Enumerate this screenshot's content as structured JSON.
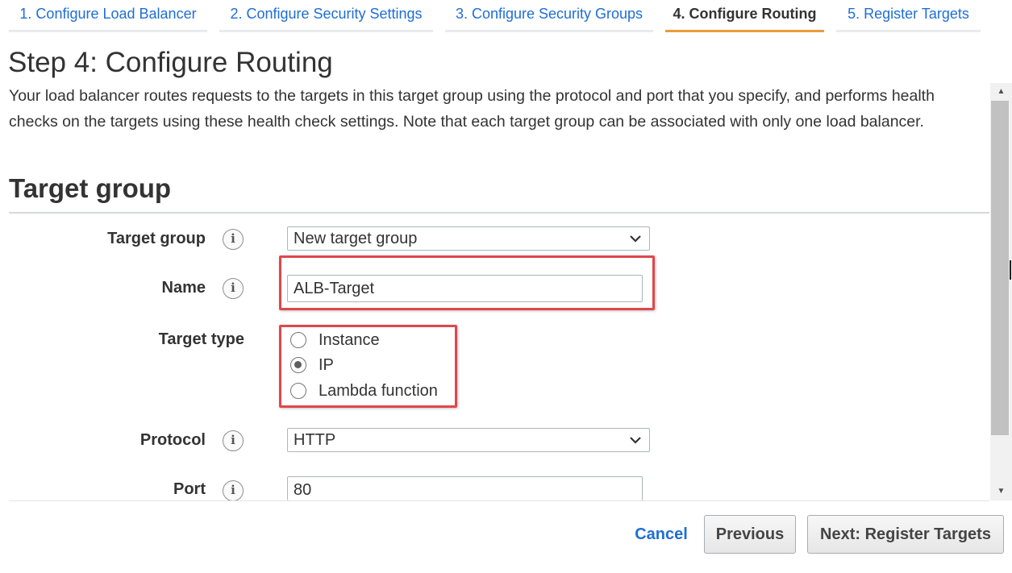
{
  "wizard": {
    "tabs": [
      {
        "label": "1. Configure Load Balancer",
        "active": false
      },
      {
        "label": "2. Configure Security Settings",
        "active": false
      },
      {
        "label": "3. Configure Security Groups",
        "active": false
      },
      {
        "label": "4. Configure Routing",
        "active": true
      },
      {
        "label": "5. Register Targets",
        "active": false
      }
    ]
  },
  "page": {
    "title": "Step 4: Configure Routing",
    "description": "Your load balancer routes requests to the targets in this target group using the protocol and port that you specify, and performs health checks on the targets using these health check settings. Note that each target group can be associated with only one load balancer."
  },
  "target_group_section": {
    "title": "Target group",
    "fields": {
      "target_group": {
        "label": "Target group",
        "value": "New target group"
      },
      "name": {
        "label": "Name",
        "value": "ALB-Target"
      },
      "target_type": {
        "label": "Target type",
        "options": [
          "Instance",
          "IP",
          "Lambda function"
        ],
        "selected": "IP"
      },
      "protocol": {
        "label": "Protocol",
        "value": "HTTP"
      },
      "port": {
        "label": "Port",
        "value": "80"
      }
    }
  },
  "footer": {
    "cancel_label": "Cancel",
    "previous_label": "Previous",
    "next_label": "Next: Register Targets"
  },
  "icons": {
    "info": "info-icon",
    "dropdown": "chevron-down-icon"
  },
  "colors": {
    "link": "#1f6ed4",
    "active_tab_underline": "#ec9b3b",
    "highlight_box": "#e0474c"
  }
}
